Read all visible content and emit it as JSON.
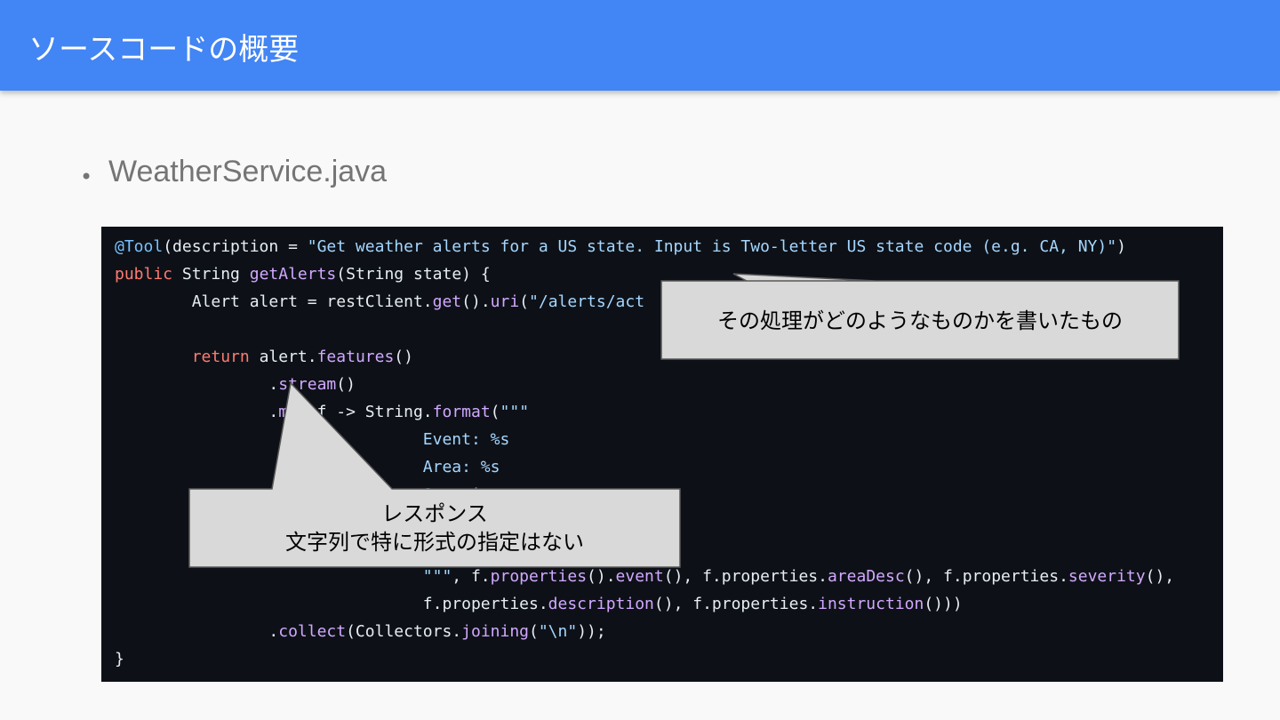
{
  "slide": {
    "title": "ソースコードの概要",
    "bullet": "WeatherService.java"
  },
  "code": {
    "l1": {
      "t0": "@Tool",
      "t1": "(description = ",
      "t2": "\"Get weather alerts for a US state. Input is Two-letter US state code (e.g. CA, NY)\"",
      "t3": ")"
    },
    "l2": {
      "t0": "public",
      "t1": " String ",
      "t2": "getAlerts",
      "t3": "(String state) {"
    },
    "l3": {
      "t0": "        Alert alert = restClient.",
      "t1": "get",
      "t2": "().",
      "t3": "uri",
      "t4": "(",
      "t5": "\"/alerts/act",
      "t6": "                                                 ",
      "t7": ");"
    },
    "l5": {
      "t0": "        ",
      "t1": "return",
      "t2": " alert.",
      "t3": "features",
      "t4": "()"
    },
    "l6": {
      "t0": "                .",
      "t1": "stream",
      "t2": "()"
    },
    "l7": {
      "t0": "                .",
      "t1": "m",
      "t2": "   f -> String.",
      "t3": "format",
      "t4": "(",
      "t5": "\"\"\""
    },
    "l8": {
      "t0": "                                ",
      "t1": "Event: %s"
    },
    "l9": {
      "t0": "                                ",
      "t1": "Area: %s"
    },
    "l10": {
      "t0": "                                ",
      "t1": "Severity: %s"
    },
    "l14": {
      "t0": "                                ",
      "t1": "\"\"\"",
      "t2": ", f.",
      "t3": "properties",
      "t4": "().",
      "t5": "event",
      "t6": "(), f.properties.",
      "t7": "areaDesc",
      "t8": "(), f.properties.",
      "t9": "severity",
      "t10": "(),"
    },
    "l15": {
      "t0": "                                f.properties.",
      "t1": "description",
      "t2": "(), f.properties.",
      "t3": "instruction",
      "t4": "()))"
    },
    "l16": {
      "t0": "                .",
      "t1": "collect",
      "t2": "(Collectors.",
      "t3": "joining",
      "t4": "(",
      "t5": "\"\\n\"",
      "t6": "));"
    },
    "l17": {
      "t0": "}"
    }
  },
  "callouts": {
    "description_note": "その処理がどのようなものかを書いたもの",
    "response_note_line1": "レスポンス",
    "response_note_line2": "文字列で特に形式の指定はない"
  },
  "colors": {
    "header": "#4285f4",
    "code_background": "#0d1117",
    "callout_fill": "#d9d9d9",
    "callout_stroke": "#595959"
  }
}
